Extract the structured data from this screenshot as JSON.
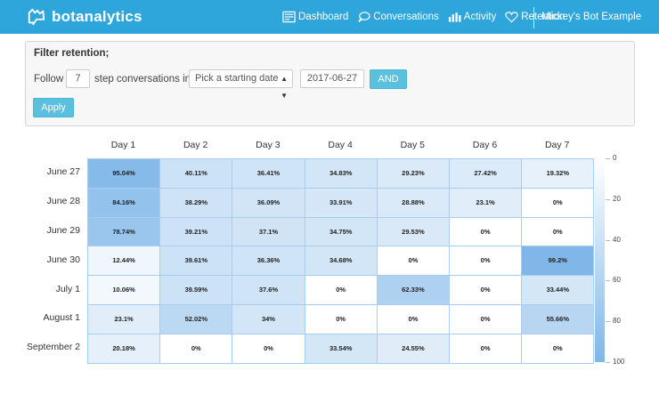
{
  "app": {
    "brand": "botanalytics",
    "bot_name": "Mickey's Bot Example"
  },
  "nav": [
    {
      "label": "Dashboard",
      "icon": "dashboard-icon"
    },
    {
      "label": "Conversations",
      "icon": "conversations-icon"
    },
    {
      "label": "Activity",
      "icon": "activity-icon"
    },
    {
      "label": "Retention",
      "icon": "heart-icon"
    }
  ],
  "filter": {
    "title": "Filter retention;",
    "follow_label": "Follow",
    "steps_value": "7",
    "step_label": "step conversations in",
    "date_select_placeholder": "Pick a starting date",
    "date_value": "2017-06-27",
    "and_label": "AND",
    "apply_label": "Apply"
  },
  "colors": {
    "topbar": "#2ea6dc",
    "button": "#5bc0de",
    "heat_low": "#ffffff",
    "heat_high": "#7fb6e8"
  },
  "chart_data": {
    "type": "heatmap",
    "columns": [
      "Day 1",
      "Day 2",
      "Day 3",
      "Day 4",
      "Day 5",
      "Day 6",
      "Day 7"
    ],
    "rows": [
      "June 27",
      "June 28",
      "June 29",
      "June 30",
      "July 1",
      "August 1",
      "September 2"
    ],
    "values": [
      [
        95.04,
        40.11,
        36.41,
        34.83,
        29.23,
        27.42,
        19.32
      ],
      [
        84.16,
        38.29,
        36.09,
        33.91,
        28.88,
        23.1,
        0
      ],
      [
        78.74,
        39.21,
        37.1,
        34.75,
        29.53,
        0,
        0
      ],
      [
        12.44,
        39.61,
        36.36,
        34.68,
        0,
        0,
        99.2
      ],
      [
        10.06,
        39.59,
        37.6,
        0,
        62.33,
        0,
        33.44
      ],
      [
        23.1,
        52.02,
        34,
        0,
        0,
        0,
        55.66
      ],
      [
        20.18,
        0,
        0,
        33.54,
        24.55,
        0,
        0
      ]
    ],
    "labels": [
      [
        "95.04%",
        "40.11%",
        "36.41%",
        "34.83%",
        "29.23%",
        "27.42%",
        "19.32%"
      ],
      [
        "84.16%",
        "38.29%",
        "36.09%",
        "33.91%",
        "28.88%",
        "23.1%",
        "0%"
      ],
      [
        "78.74%",
        "39.21%",
        "37.1%",
        "34.75%",
        "29.53%",
        "0%",
        "0%"
      ],
      [
        "12.44%",
        "39.61%",
        "36.36%",
        "34.68%",
        "0%",
        "0%",
        "99.2%"
      ],
      [
        "10.06%",
        "39.59%",
        "37.6%",
        "0%",
        "62.33%",
        "0%",
        "33.44%"
      ],
      [
        "23.1%",
        "52.02%",
        "34%",
        "0%",
        "0%",
        "0%",
        "55.66%"
      ],
      [
        "20.18%",
        "0%",
        "0%",
        "33.54%",
        "24.55%",
        "0%",
        "0%"
      ]
    ],
    "color_scale": {
      "min": 0,
      "max": 100,
      "ticks": [
        "0",
        "20",
        "40",
        "60",
        "80",
        "100"
      ]
    }
  }
}
